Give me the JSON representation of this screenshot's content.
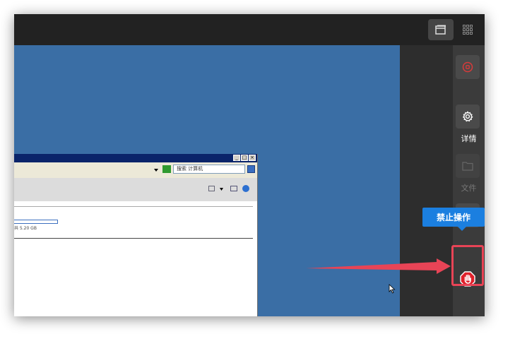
{
  "sidebar": {
    "details_label": "详情",
    "files_label": "文件",
    "stop_tooltip": "禁止操作"
  },
  "remote_window": {
    "search_placeholder": "搜索 计算机",
    "disk_info": "共 5.20 GB"
  },
  "colors": {
    "desktop": "#3a6ea5",
    "tooltip": "#1b7fe0",
    "highlight": "#e84456",
    "stop_button": "#e0202a"
  },
  "icons": [
    "window-icon",
    "grid-icon",
    "record-icon",
    "gear-icon",
    "folder-icon",
    "share-icon",
    "stop-hand-icon",
    "mouse-cursor-icon"
  ]
}
